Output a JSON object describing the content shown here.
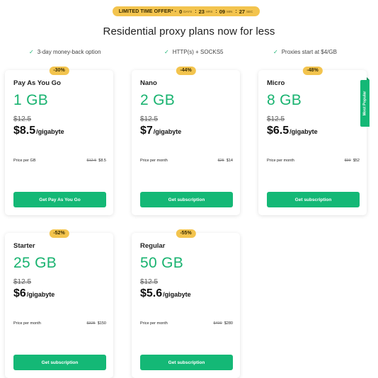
{
  "offer": {
    "label": "LIMITED TIME OFFER* -",
    "days": "0",
    "days_unit": "DAYS",
    "hours": "23",
    "hours_unit": "HRS",
    "minutes": "09",
    "minutes_unit": "MIN",
    "seconds": "27",
    "seconds_unit": "SEC",
    "separator": ":"
  },
  "headline": "Residential proxy plans now for less",
  "features": [
    "3-day money-back option",
    "HTTP(s) + SOCKS5",
    "Proxies start at $4/GB"
  ],
  "check_glyph": "✓",
  "ribbon": "Most Popular",
  "plans": [
    {
      "badge": "-30%",
      "name": "Pay As You Go",
      "size": "1 GB",
      "old_rate": "$12.5",
      "rate": "$8.5",
      "rate_unit": "/gigabyte",
      "price_label": "Price per GB",
      "price_old": "$12.5",
      "price_new": "$8.5",
      "cta": "Get Pay As You Go"
    },
    {
      "badge": "-44%",
      "name": "Nano",
      "size": "2 GB",
      "old_rate": "$12.5",
      "rate": "$7",
      "rate_unit": "/gigabyte",
      "price_label": "Price per month",
      "price_old": "$25",
      "price_new": "$14",
      "cta": "Get subscription"
    },
    {
      "badge": "-48%",
      "name": "Micro",
      "size": "8 GB",
      "old_rate": "$12.5",
      "rate": "$6.5",
      "rate_unit": "/gigabyte",
      "price_label": "Price per month",
      "price_old": "$99",
      "price_new": "$52",
      "cta": "Get subscription"
    },
    {
      "badge": "-52%",
      "name": "Starter",
      "size": "25 GB",
      "old_rate": "$12.5",
      "rate": "$6",
      "rate_unit": "/gigabyte",
      "price_label": "Price per month",
      "price_old": "$325",
      "price_new": "$150",
      "cta": "Get subscription"
    },
    {
      "badge": "-55%",
      "name": "Regular",
      "size": "50 GB",
      "old_rate": "$12.5",
      "rate": "$5.6",
      "rate_unit": "/gigabyte",
      "price_label": "Price per month",
      "price_old": "$400",
      "price_new": "$280",
      "cta": "Get subscription"
    }
  ],
  "colors": {
    "accent": "#14b876",
    "offer_bg": "#f3c44e"
  }
}
